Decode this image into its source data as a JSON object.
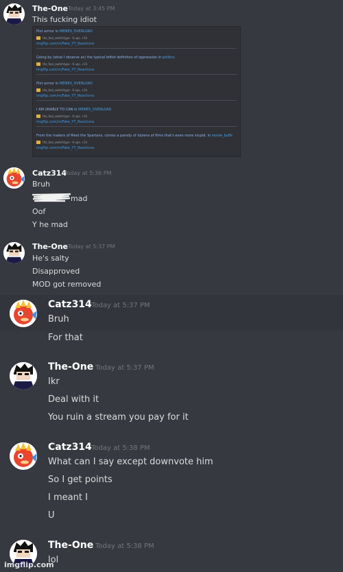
{
  "messages": [
    {
      "user": "The-One",
      "time": "Today at 3:45 PM",
      "lines": [
        "This fucking idiot"
      ]
    },
    {
      "user": "Catz314",
      "time": "Today at 5:36 PM",
      "lines": [
        "Bruh",
        "mad",
        "Oof",
        "Y he mad"
      ]
    },
    {
      "user": "The-One",
      "time": "Today at 5:37 PM",
      "lines": [
        "He's salty",
        "Disapproved",
        "MOD got removed"
      ]
    },
    {
      "user": "Catz314",
      "time": "Today at 5:37 PM",
      "lines": [
        "Bruh",
        "For that"
      ]
    },
    {
      "user": "The-One",
      "time": "Today at 5:37 PM",
      "lines": [
        "Ikr",
        "Deal with it",
        "You ruin a stream you pay for it"
      ]
    },
    {
      "user": "Catz314",
      "time": "Today at 5:38 PM",
      "lines": [
        "What can I say except downvote him",
        "So I get points",
        "I meant I",
        "U"
      ]
    },
    {
      "user": "The-One",
      "time": "Today at 5:38 PM",
      "lines": [
        "lol"
      ]
    }
  ],
  "embed": {
    "rows": [
      {
        "title": "Plot armor",
        "in": "in",
        "sub": "MEMES_OVERLOAD",
        "meta": "the_fool_switchtype · 6 ups, <1h",
        "link": "imgflip.com/m/Fake_YT_Reactions"
      },
      {
        "title": "Going by (what I observe as) the typical leftist definition of oppression",
        "in": "in",
        "sub": "politics",
        "meta": "the_fool_switchtype · 6 ups, <1h",
        "link": "imgflip.com/m/Fake_YT_Reactions"
      },
      {
        "title": "Plot armor",
        "in": "in",
        "sub": "MEMES_OVERLOAD",
        "meta": "the_fool_switchtype · 6 ups, <1h",
        "link": "imgflip.com/m/Fake_YT_Reactions"
      },
      {
        "title": "I AM UNABLE TO CAN",
        "in": "in",
        "sub": "MEMES_OVERLOAD",
        "meta": "the_fool_switchtype · 6 ups, <1h",
        "link": "imgflip.com/m/Fake_YT_Reactions"
      },
      {
        "title": "From the makers of Meet the Spartans, comes a parody of dozens of films that's even more stupid.",
        "in": "in",
        "sub": "movie_buffs",
        "meta": "the_fool_switchtype · 6 ups, <1h",
        "link": "imgflip.com/m/Fake_YT_Reactions"
      }
    ]
  },
  "watermark": "imgflip.com",
  "colors": {
    "background": "#36393f",
    "username": "#ffffff",
    "timestamp": "#72767d",
    "text": "#dcddde",
    "link": "#3f9bea"
  }
}
